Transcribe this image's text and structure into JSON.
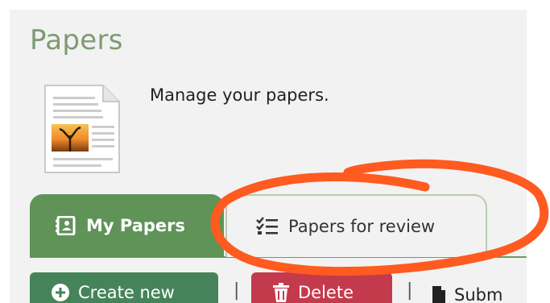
{
  "page": {
    "title": "Papers",
    "description": "Manage your papers."
  },
  "tabs": [
    {
      "label": "My Papers",
      "active": true,
      "icon": "address-book-icon"
    },
    {
      "label": "Papers for review",
      "active": false,
      "icon": "checklist-icon"
    }
  ],
  "actions": {
    "create_label": "Create new",
    "delete_label": "Delete",
    "submit_label": "Subm",
    "separator": "|"
  },
  "colors": {
    "accent_green": "#5f9358",
    "title_green": "#7e9b72",
    "create_green": "#45845a",
    "delete_red": "#c43a4d",
    "annotation_orange": "#ff5a1f"
  }
}
